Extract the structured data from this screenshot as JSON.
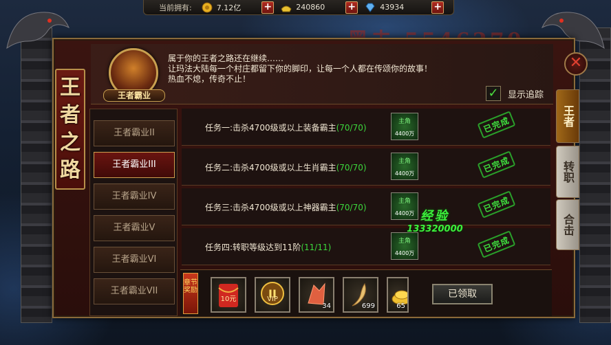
{
  "resource_bar": {
    "label": "当前拥有:",
    "gold": "7.12亿",
    "ingot": "240860",
    "diamond": "43934",
    "plus": "+"
  },
  "title_chars": [
    "王",
    "者",
    "之",
    "路"
  ],
  "avatar_label": "王者霸业",
  "description": [
    "属于你的王者之路还在继续……",
    "让玛法大陆每一个村庄都留下你的脚印，让每一个人都在传颂你的故事！",
    "热血不熄，传奇不止！"
  ],
  "track": {
    "label": "显示追踪",
    "checked": true,
    "check_glyph": "✓"
  },
  "side_tabs": [
    {
      "label": "王者",
      "active": true
    },
    {
      "label": "转职",
      "active": false
    },
    {
      "label": "合击",
      "active": false
    }
  ],
  "chapters": [
    {
      "label": "王者霸业II",
      "active": false
    },
    {
      "label": "王者霸业III",
      "active": true
    },
    {
      "label": "王者霸业IV",
      "active": false
    },
    {
      "label": "王者霸业V",
      "active": false
    },
    {
      "label": "王者霸业VI",
      "active": false
    },
    {
      "label": "王者霸业VII",
      "active": false
    }
  ],
  "tasks": [
    {
      "text": "任务一:击杀4700级或以上装备霸主",
      "progress": "(70/70)",
      "reward_name": "主角",
      "reward_amount": "4400万",
      "status": "已完成"
    },
    {
      "text": "任务二:击杀4700级或以上生肖霸主",
      "progress": "(70/70)",
      "reward_name": "主角",
      "reward_amount": "4400万",
      "status": "已完成"
    },
    {
      "text": "任务三:击杀4700级或以上神器霸主",
      "progress": "(70/70)",
      "reward_name": "主角",
      "reward_amount": "4400万",
      "status": "已完成"
    },
    {
      "text": "任务四:转职等级达到11阶",
      "progress": "(11/11)",
      "reward_name": "主角",
      "reward_amount": "4400万",
      "status": "已完成"
    }
  ],
  "exp_popup": {
    "title": "经验",
    "value": "133320000"
  },
  "chapter_reward": {
    "label": "章节奖励",
    "items": [
      {
        "name": "red-envelope",
        "title": "10元",
        "count": ""
      },
      {
        "name": "vip-badge",
        "title": "VIP",
        "count": ""
      },
      {
        "name": "crystal",
        "title": "",
        "count": "34"
      },
      {
        "name": "ginseng",
        "title": "",
        "count": "699"
      },
      {
        "name": "gold-ingots",
        "title": "",
        "count": "65"
      }
    ],
    "claim_label": "已领取"
  },
  "close_glyph": "✕",
  "colors": {
    "progress": "#3cd83c",
    "accent_red": "#6a1410",
    "gold_border": "#c8a050"
  }
}
